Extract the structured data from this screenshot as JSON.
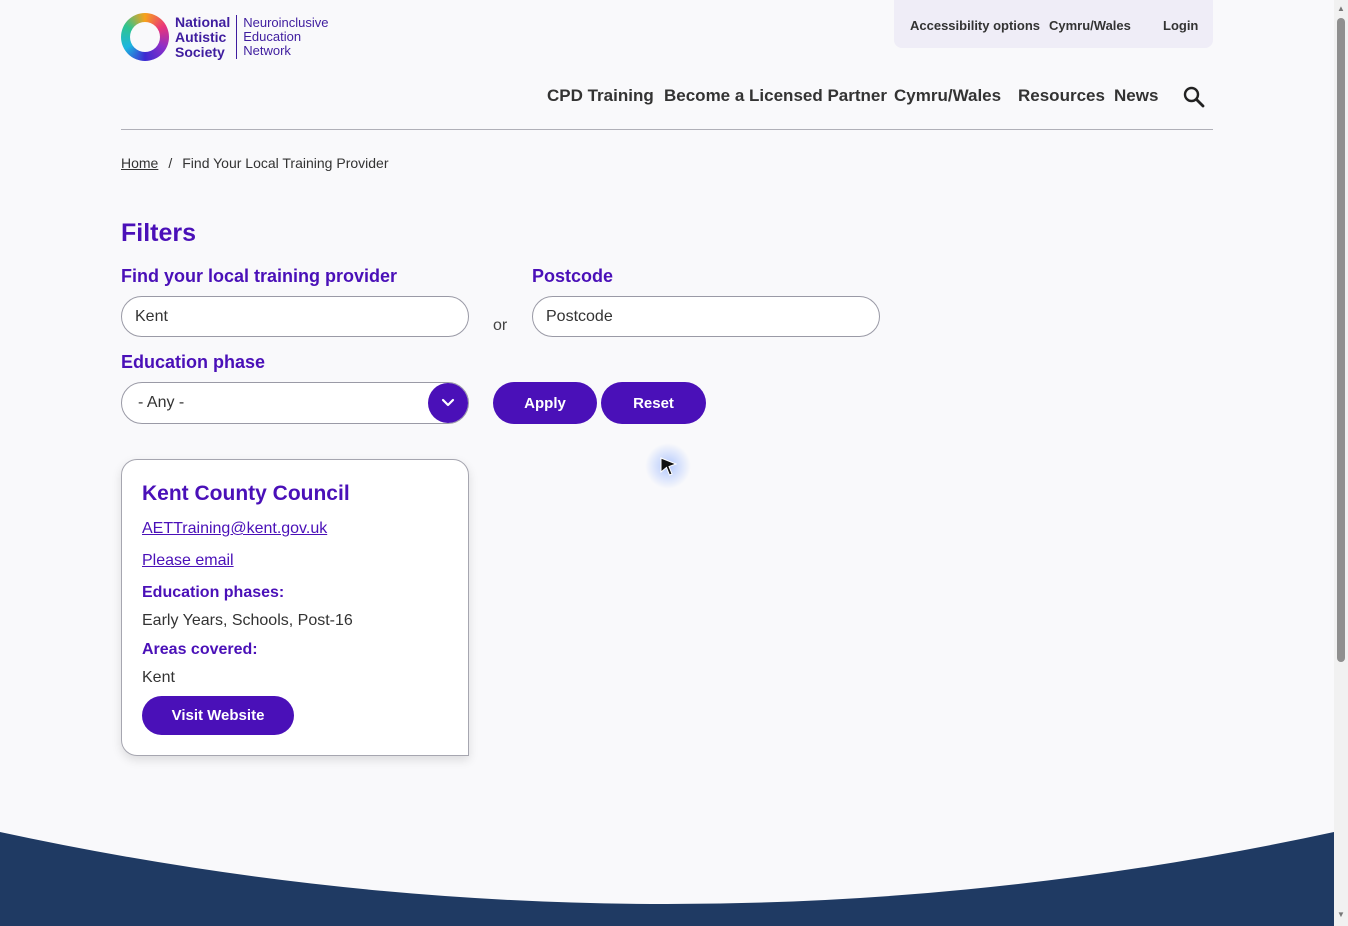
{
  "utility": {
    "accessibility": "Accessibility options",
    "cymru": "Cymru/Wales",
    "login": "Login"
  },
  "logo": {
    "line1": "National",
    "line2": "Autistic",
    "line3": "Society",
    "right1": "Neuroinclusive",
    "right2": "Education",
    "right3": "Network"
  },
  "nav": {
    "cpd": "CPD Training",
    "partner": "Become a Licensed Partner",
    "cymru": "Cymru/Wales",
    "resources": "Resources",
    "news": "News"
  },
  "breadcrumb": {
    "home": "Home",
    "separator": "/",
    "current": "Find Your Local Training Provider"
  },
  "filters": {
    "title": "Filters",
    "provider_label": "Find your local training provider",
    "provider_value": "Kent",
    "or": "or",
    "postcode_label": "Postcode",
    "postcode_placeholder": "Postcode",
    "phase_label": "Education phase",
    "phase_value": "- Any -",
    "apply": "Apply",
    "reset": "Reset"
  },
  "result": {
    "title": "Kent County Council",
    "email": "AETTraining@kent.gov.uk",
    "contact": "Please email",
    "phases_label": "Education phases:",
    "phases_value": "Early Years, Schools, Post-16",
    "areas_label": "Areas covered:",
    "areas_value": "Kent",
    "website_button": "Visit Website"
  },
  "colors": {
    "brand": "#4a10b8",
    "footer": "#1f3a63"
  }
}
